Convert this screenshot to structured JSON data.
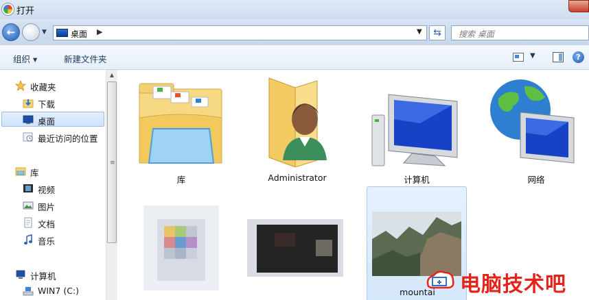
{
  "window": {
    "title": "打开"
  },
  "nav": {
    "address_segment": "桌面",
    "search_placeholder": "搜索 桌面"
  },
  "toolbar": {
    "organize_label": "组织 ▾",
    "new_folder_label": "新建文件夹"
  },
  "sidebar": {
    "items": [
      {
        "label": "收藏夹",
        "icon": "star-icon"
      },
      {
        "label": "下载",
        "icon": "download-folder-icon"
      },
      {
        "label": "桌面",
        "icon": "desktop-icon",
        "selected": true
      },
      {
        "label": "最近访问的位置",
        "icon": "recent-places-icon"
      },
      {
        "label": "库",
        "icon": "library-icon"
      },
      {
        "label": "视频",
        "icon": "video-icon"
      },
      {
        "label": "图片",
        "icon": "pictures-icon"
      },
      {
        "label": "文档",
        "icon": "documents-icon"
      },
      {
        "label": "音乐",
        "icon": "music-icon"
      },
      {
        "label": "计算机",
        "icon": "computer-icon"
      },
      {
        "label": "WIN7 (C:)",
        "icon": "drive-icon"
      }
    ]
  },
  "content": {
    "tiles": [
      {
        "label": "库",
        "icon": "library-folder-icon"
      },
      {
        "label": "Administrator",
        "icon": "user-folder-icon"
      },
      {
        "label": "计算机",
        "icon": "computer-icon"
      },
      {
        "label": "网络",
        "icon": "network-icon"
      },
      {
        "label": "",
        "icon": "blurred-file-icon"
      },
      {
        "label": "",
        "icon": "blurred-file-icon"
      },
      {
        "label": "mountai",
        "icon": "image-thumbnail-icon",
        "selected": true
      }
    ]
  },
  "watermark": {
    "text": "电脑技术吧"
  }
}
